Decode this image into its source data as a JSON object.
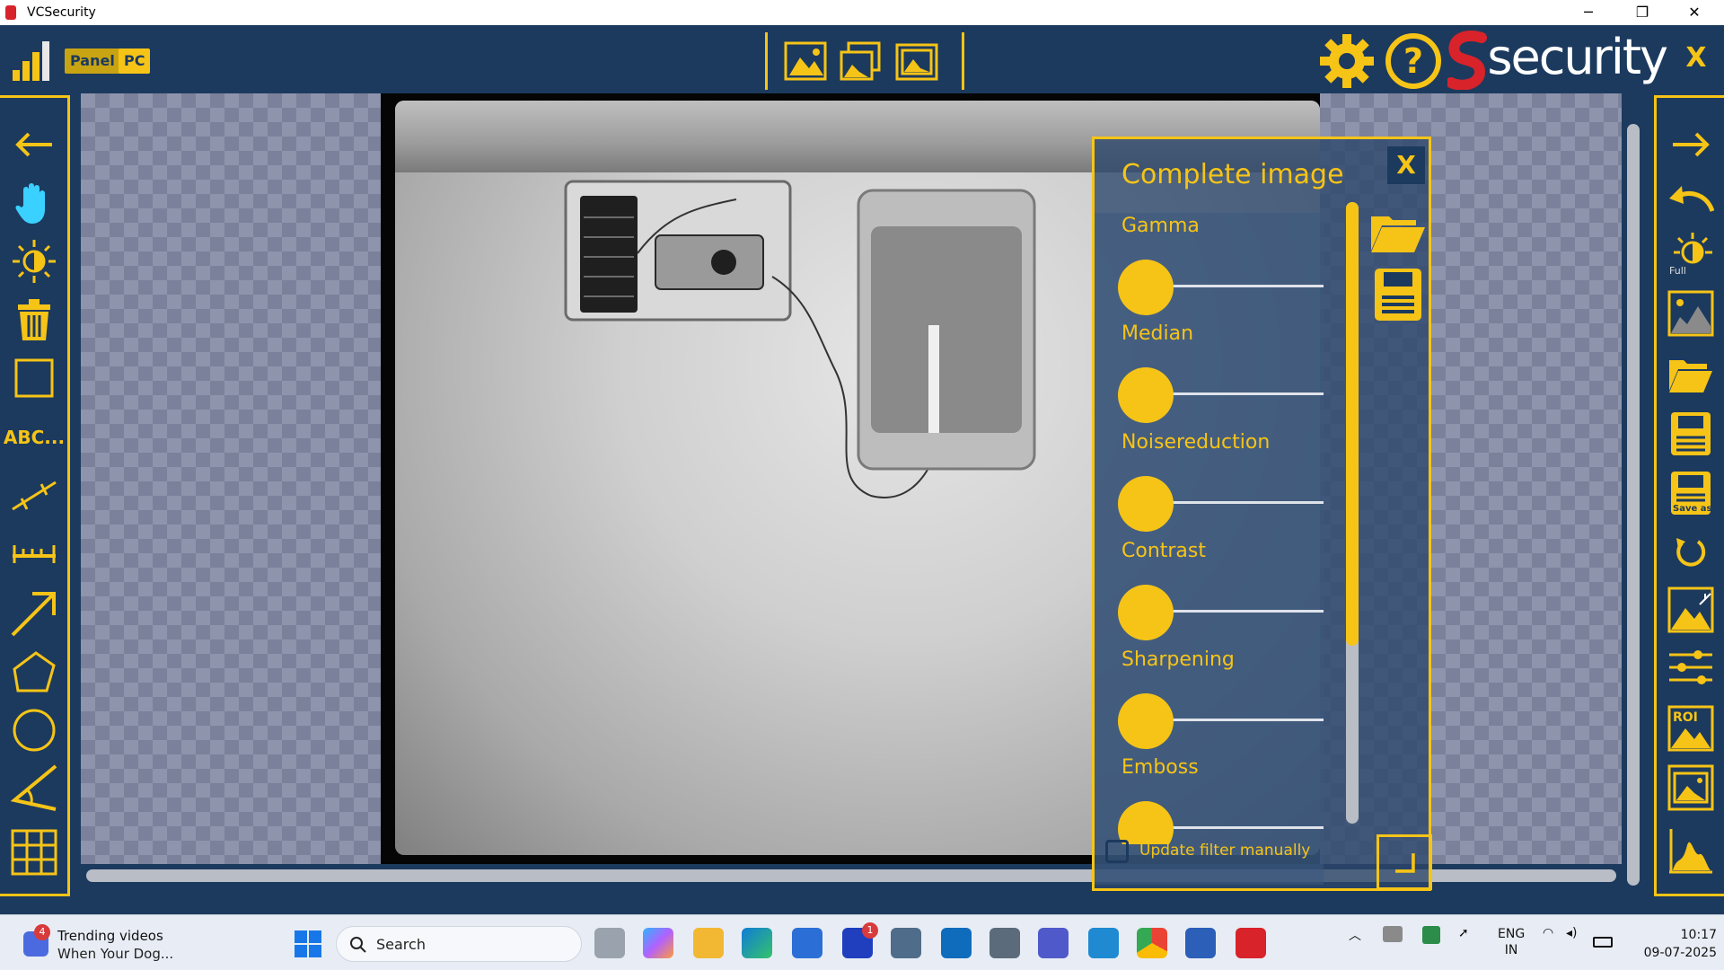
{
  "window": {
    "title": "VCSecurity",
    "minimize": "─",
    "restore": "❐",
    "close": "✕"
  },
  "topbar": {
    "panel_label": "Panel",
    "pc_label": "PC",
    "brand": "security",
    "close_label": "X"
  },
  "left_tools": {
    "text_tool_label": "ABC..."
  },
  "right_tools": {
    "full_label": "Full",
    "saveas_label": "Save as",
    "roi_label": "ROI"
  },
  "filter_panel": {
    "title": "Complete image",
    "close_label": "X",
    "filters": [
      {
        "label": "Gamma",
        "value": 0
      },
      {
        "label": "Median",
        "value": 0
      },
      {
        "label": "Noisereduction",
        "value": 0
      },
      {
        "label": "Contrast",
        "value": 0
      },
      {
        "label": "Sharpening",
        "value": 0
      },
      {
        "label": "Emboss",
        "value": 0
      }
    ],
    "update_manually_label": "Update filter manually",
    "update_manually_checked": false
  },
  "taskbar": {
    "news_badge": "4",
    "news_title": "Trending videos",
    "news_subtitle": "When Your Dog...",
    "search_placeholder": "Search",
    "l_badge": "1",
    "lang_line1": "ENG",
    "lang_line2": "IN",
    "time": "10:17",
    "date": "09-07-2025"
  },
  "colors": {
    "accent": "#f6c417",
    "background": "#1c3a5e",
    "brand_red": "#d8232a"
  }
}
